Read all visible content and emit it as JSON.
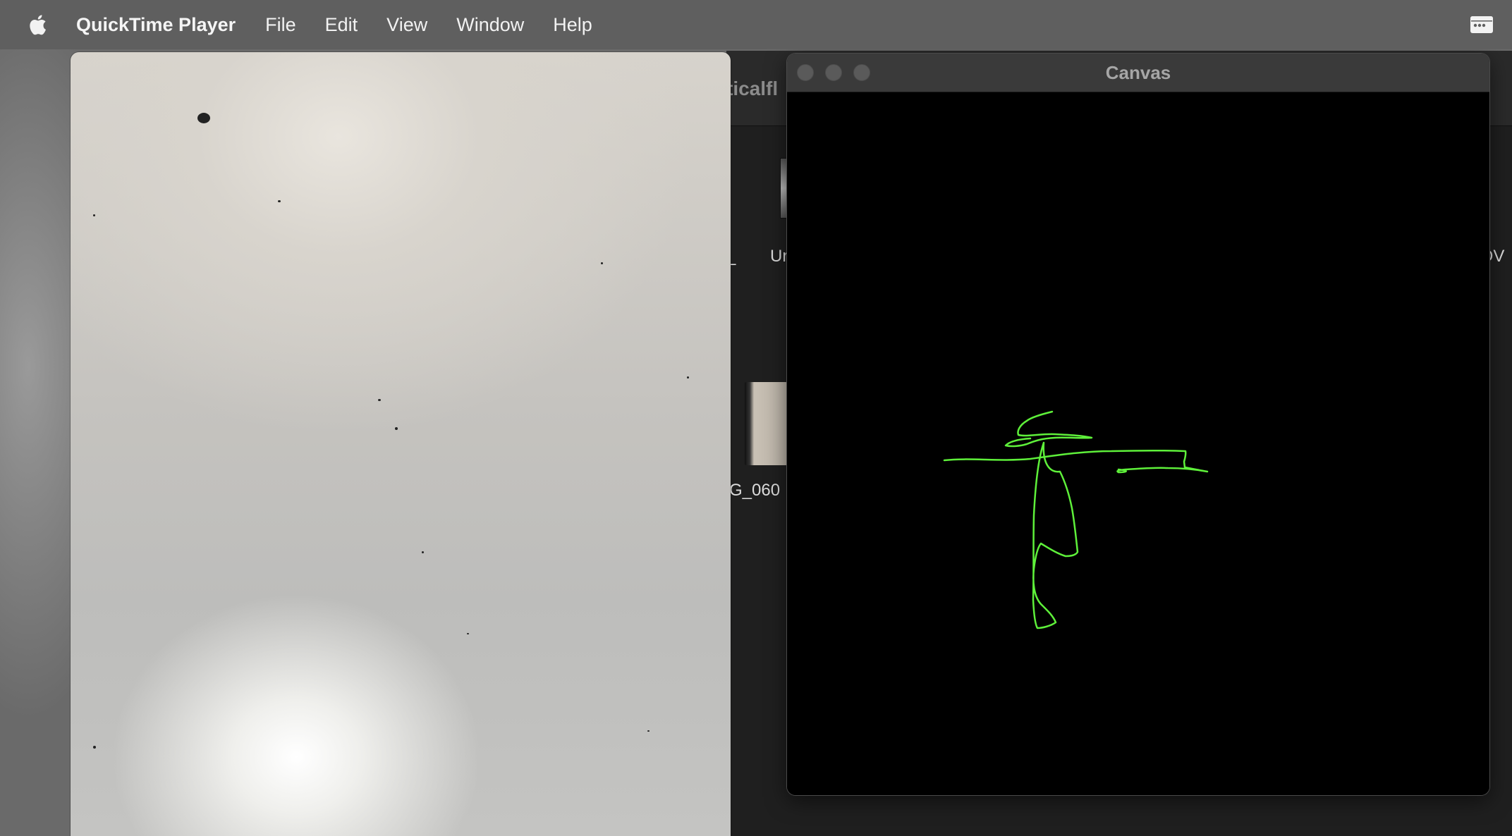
{
  "menubar": {
    "app_name": "QuickTime Player",
    "items": [
      "File",
      "Edit",
      "View",
      "Window",
      "Help"
    ],
    "apple_icon": "apple-logo-icon",
    "right_icon": "control-center-icon"
  },
  "finder": {
    "title_fragment": "ticalfl",
    "label_left_top": "_",
    "label_un": "Ur",
    "label_right_top": "DV",
    "label_img": "G_060"
  },
  "canvas_window": {
    "title": "Canvas",
    "stroke_color": "#5ef03a",
    "background": "#000000"
  },
  "colors": {
    "menubar": "#5f5f5f",
    "finder_bg": "#1f1f1f"
  }
}
